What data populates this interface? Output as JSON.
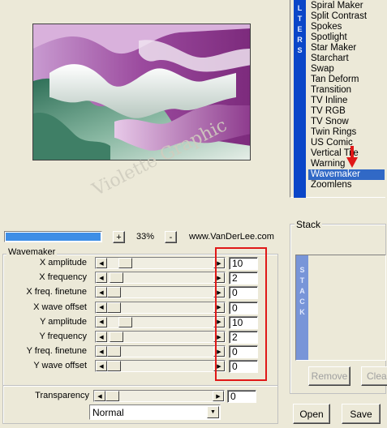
{
  "preview": {
    "watermark": "Violette Graphic"
  },
  "zoom": {
    "minus": "-",
    "plus": "+",
    "value": "33%",
    "brand": "www.VanDerLee.com",
    "progress_fraction": 1.0
  },
  "filters": {
    "tab_label": "FILTERS",
    "visible_tab_text": "LTERS",
    "items": [
      "Spiral Maker",
      "Split Contrast",
      "Spokes",
      "Spotlight",
      "Star Maker",
      "Starchart",
      "Swap",
      "Tan Deform",
      "Transition",
      "TV Inline",
      "TV RGB",
      "TV Snow",
      "Twin Rings",
      "US Comic",
      "Vertical Tile",
      "Warning",
      "Wavemaker",
      "Zoomlens"
    ],
    "selected": "Wavemaker"
  },
  "stack": {
    "title": "Stack",
    "tab_label": "STACK",
    "remove_label": "Remove",
    "clear_label": "Clear"
  },
  "wavemaker": {
    "title": "Wavemaker",
    "params": [
      {
        "label": "X amplitude",
        "value": "10",
        "level": 0.12
      },
      {
        "label": "X frequency",
        "value": "2",
        "level": 0.03
      },
      {
        "label": "X freq. finetune",
        "value": "0",
        "level": 0.0
      },
      {
        "label": "X wave offset",
        "value": "0",
        "level": 0.0
      },
      {
        "label": "Y amplitude",
        "value": "10",
        "level": 0.12
      },
      {
        "label": "Y frequency",
        "value": "2",
        "level": 0.03
      },
      {
        "label": "Y freq. finetune",
        "value": "0",
        "level": 0.0
      },
      {
        "label": "Y wave offset",
        "value": "0",
        "level": 0.0
      }
    ]
  },
  "transparency": {
    "label": "Transparency",
    "value": "0",
    "level": 0.0
  },
  "blend_mode": {
    "selected": "Normal"
  },
  "buttons": {
    "open": "Open",
    "save": "Save"
  },
  "colors": {
    "selection": "#3169c6",
    "tab_blue": "#0a46c8",
    "highlight_red": "#e01818"
  }
}
